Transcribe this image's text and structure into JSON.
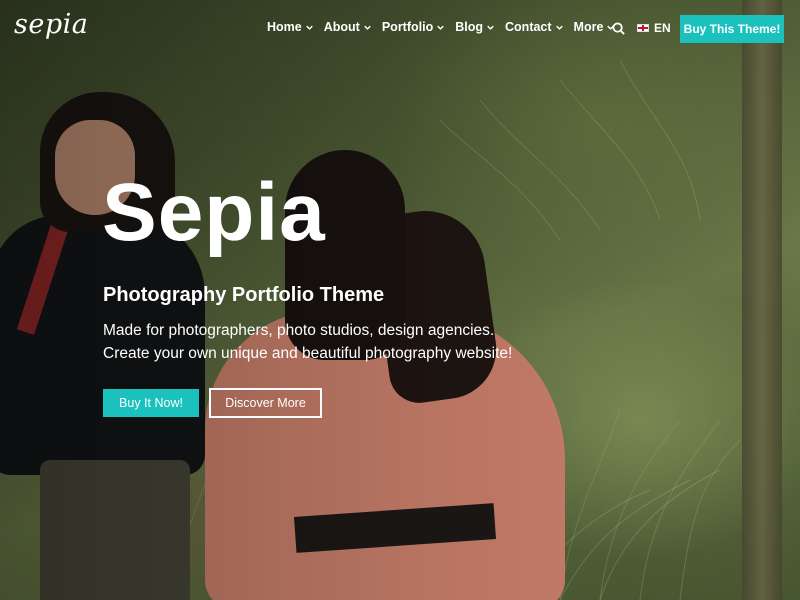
{
  "brand": {
    "logo_text": "sepia"
  },
  "nav": {
    "items": [
      {
        "label": "Home"
      },
      {
        "label": "About"
      },
      {
        "label": "Portfolio"
      },
      {
        "label": "Blog"
      },
      {
        "label": "Contact"
      },
      {
        "label": "More"
      }
    ],
    "search_icon": "search-icon",
    "language": {
      "code": "EN",
      "flag_icon": "flag-icon"
    },
    "cta_label": "Buy This Theme!"
  },
  "hero": {
    "title": "Sepia",
    "subtitle": "Photography Portfolio Theme",
    "description_line1": "Made for photographers, photo studios, design agencies.",
    "description_line2": "Create your own unique and beautiful photography website!",
    "primary_button": "Buy It Now!",
    "secondary_button": "Discover More"
  },
  "colors": {
    "accent": "#1bc2bd",
    "text": "#ffffff"
  }
}
